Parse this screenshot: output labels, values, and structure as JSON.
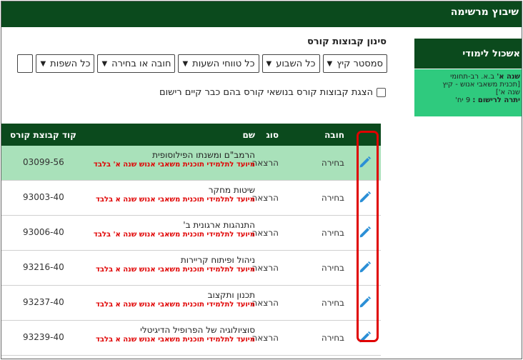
{
  "header": {
    "title": "שיבוץ מרשימה"
  },
  "filters": {
    "title": "סינון קבוצות קורס",
    "selects": [
      {
        "value": "סמסטר קיץ"
      },
      {
        "value": "כל השבוע"
      },
      {
        "value": "כל טווחי השעות"
      },
      {
        "value": "חובה או בחירה"
      },
      {
        "value": "כל השפות"
      }
    ],
    "checkbox_label": "הצגת קבוצות קורס בנושאי קורס בהם כבר קיים רישום"
  },
  "table": {
    "columns": {
      "obligation": "חובה",
      "type": "סוג",
      "name": "שם",
      "code": "קוד קבוצת קורס"
    },
    "rows": [
      {
        "obligation": "בחירה",
        "type": "הרצאה",
        "name": "הרמב\"ם ומשנתו הפילוסופית",
        "note": "מיועד לתלמידי תוכנית משאבי אנוש שנה א' בלבד",
        "code": "03099-56"
      },
      {
        "obligation": "בחירה",
        "type": "הרצאה",
        "name": "שיטות מחקר",
        "note": "מיועד לתלמידי תוכנית משאבי אנוש שנה א בלבד",
        "code": "93003-40"
      },
      {
        "obligation": "בחירה",
        "type": "הרצאה",
        "name": "התנהגות ארגונית ב'",
        "note": "מיועד לתלמידי תוכנית משאבי אנוש שנה א' בלבד",
        "code": "93006-40"
      },
      {
        "obligation": "בחירה",
        "type": "הרצאה",
        "name": "ניהול ופיתוח קריירות",
        "note": "מיועד לתלמידי תוכנית משאבי אנוש שנה א בלבד",
        "code": "93216-40"
      },
      {
        "obligation": "בחירה",
        "type": "הרצאה",
        "name": "תכנון ותקצוב",
        "note": "מיועד לתלמידי תוכנית משאבי אנוש שנה א בלבד",
        "code": "93237-40"
      },
      {
        "obligation": "בחירה",
        "type": "הרצאה",
        "name": "סוציולוגיה של הפרופיל הדיגיטלי",
        "note": "מיועד לתלמידי תוכנית משאבי אנוש שנה א בלבד",
        "code": "93239-40"
      }
    ]
  },
  "sidebar": {
    "title": "אשכול לימודי",
    "year_label": "שנה א'",
    "year_text": "ב.א. רב-תחומי",
    "program": "[תכנית משאבי אנוש - קיץ",
    "program2": "שנה א']",
    "balance_label": "יתרה לרישום :",
    "balance_value": "9 יח'"
  },
  "icons": {
    "edit": "pencil-icon",
    "chevron": "chevron-down-icon"
  },
  "colors": {
    "brand": "#0b4a1d",
    "accent": "#2fca7e",
    "highlight": "#a9e1ba",
    "warning": "#e00000",
    "icon": "#2b8fd6"
  }
}
